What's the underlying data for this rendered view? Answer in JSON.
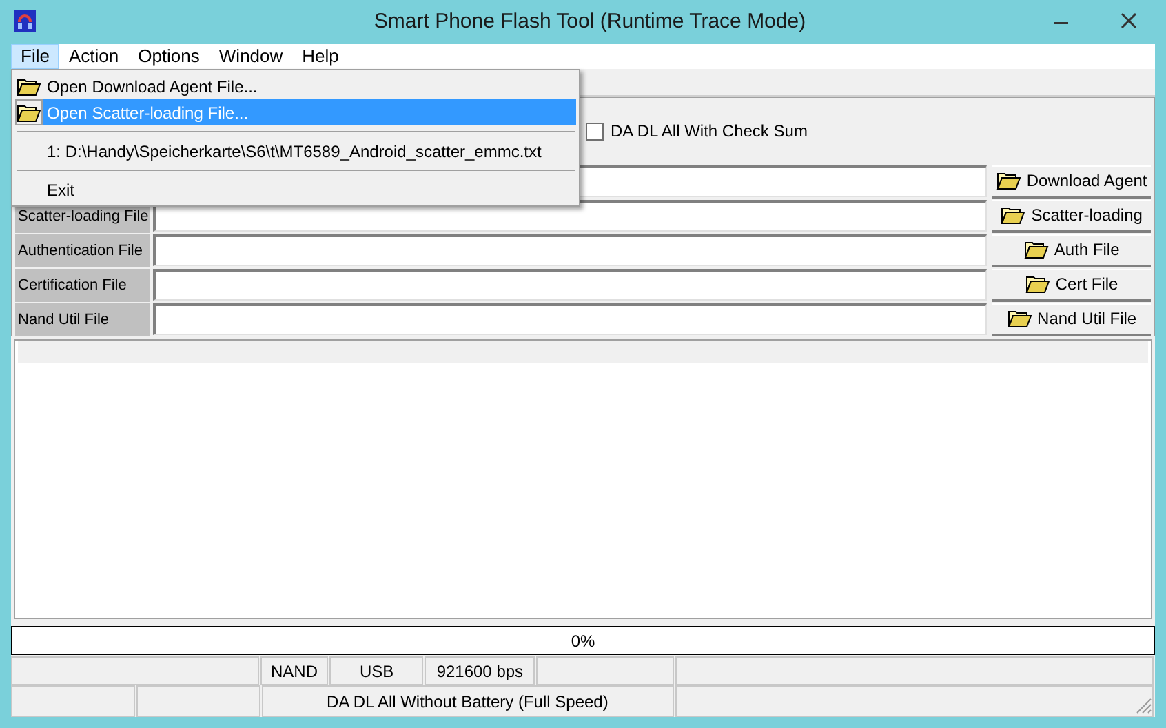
{
  "window": {
    "title": "Smart Phone Flash Tool (Runtime Trace Mode)"
  },
  "menu": [
    {
      "label": "File",
      "selected": true
    },
    {
      "label": "Action",
      "selected": false
    },
    {
      "label": "Options",
      "selected": false
    },
    {
      "label": "Window",
      "selected": false
    },
    {
      "label": "Help",
      "selected": false
    }
  ],
  "file_menu": [
    {
      "kind": "item",
      "label": "Open Download Agent File...",
      "icon": true,
      "selected": false
    },
    {
      "kind": "item",
      "label": "Open Scatter-loading File...",
      "icon": true,
      "selected": true
    },
    {
      "kind": "separator"
    },
    {
      "kind": "item",
      "label": "1: D:\\Handy\\Speicherkarte\\S6\\t\\MT6589_Android_scatter_emmc.txt",
      "icon": false,
      "selected": false
    },
    {
      "kind": "separator"
    },
    {
      "kind": "item",
      "label": "Exit",
      "icon": false,
      "selected": false
    }
  ],
  "checkbox": {
    "label": "DA DL All With Check Sum",
    "checked": false
  },
  "file_rows": [
    {
      "button": "Download Agent"
    },
    {
      "label": "Scatter-loading File",
      "button": "Scatter-loading"
    },
    {
      "label": "Authentication File",
      "button": "Auth File"
    },
    {
      "label": "Certification File",
      "button": "Cert File"
    },
    {
      "label": "Nand Util File",
      "button": "Nand Util File"
    }
  ],
  "progress": {
    "text": "0%",
    "level": 0
  },
  "status_bar": {
    "row_1": [
      {
        "kind": "blank"
      },
      {
        "kind": "text",
        "text": "NAND"
      },
      {
        "kind": "text",
        "text": "USB"
      },
      {
        "kind": "text",
        "text": "921600 bps"
      },
      {
        "kind": "blank"
      },
      {
        "kind": "blank"
      }
    ],
    "row_2": [
      {
        "kind": "blank"
      },
      {
        "kind": "blank"
      },
      {
        "kind": "text",
        "text": "DA DL All Without Battery (Full Speed)"
      },
      {
        "kind": "blank"
      }
    ]
  }
}
